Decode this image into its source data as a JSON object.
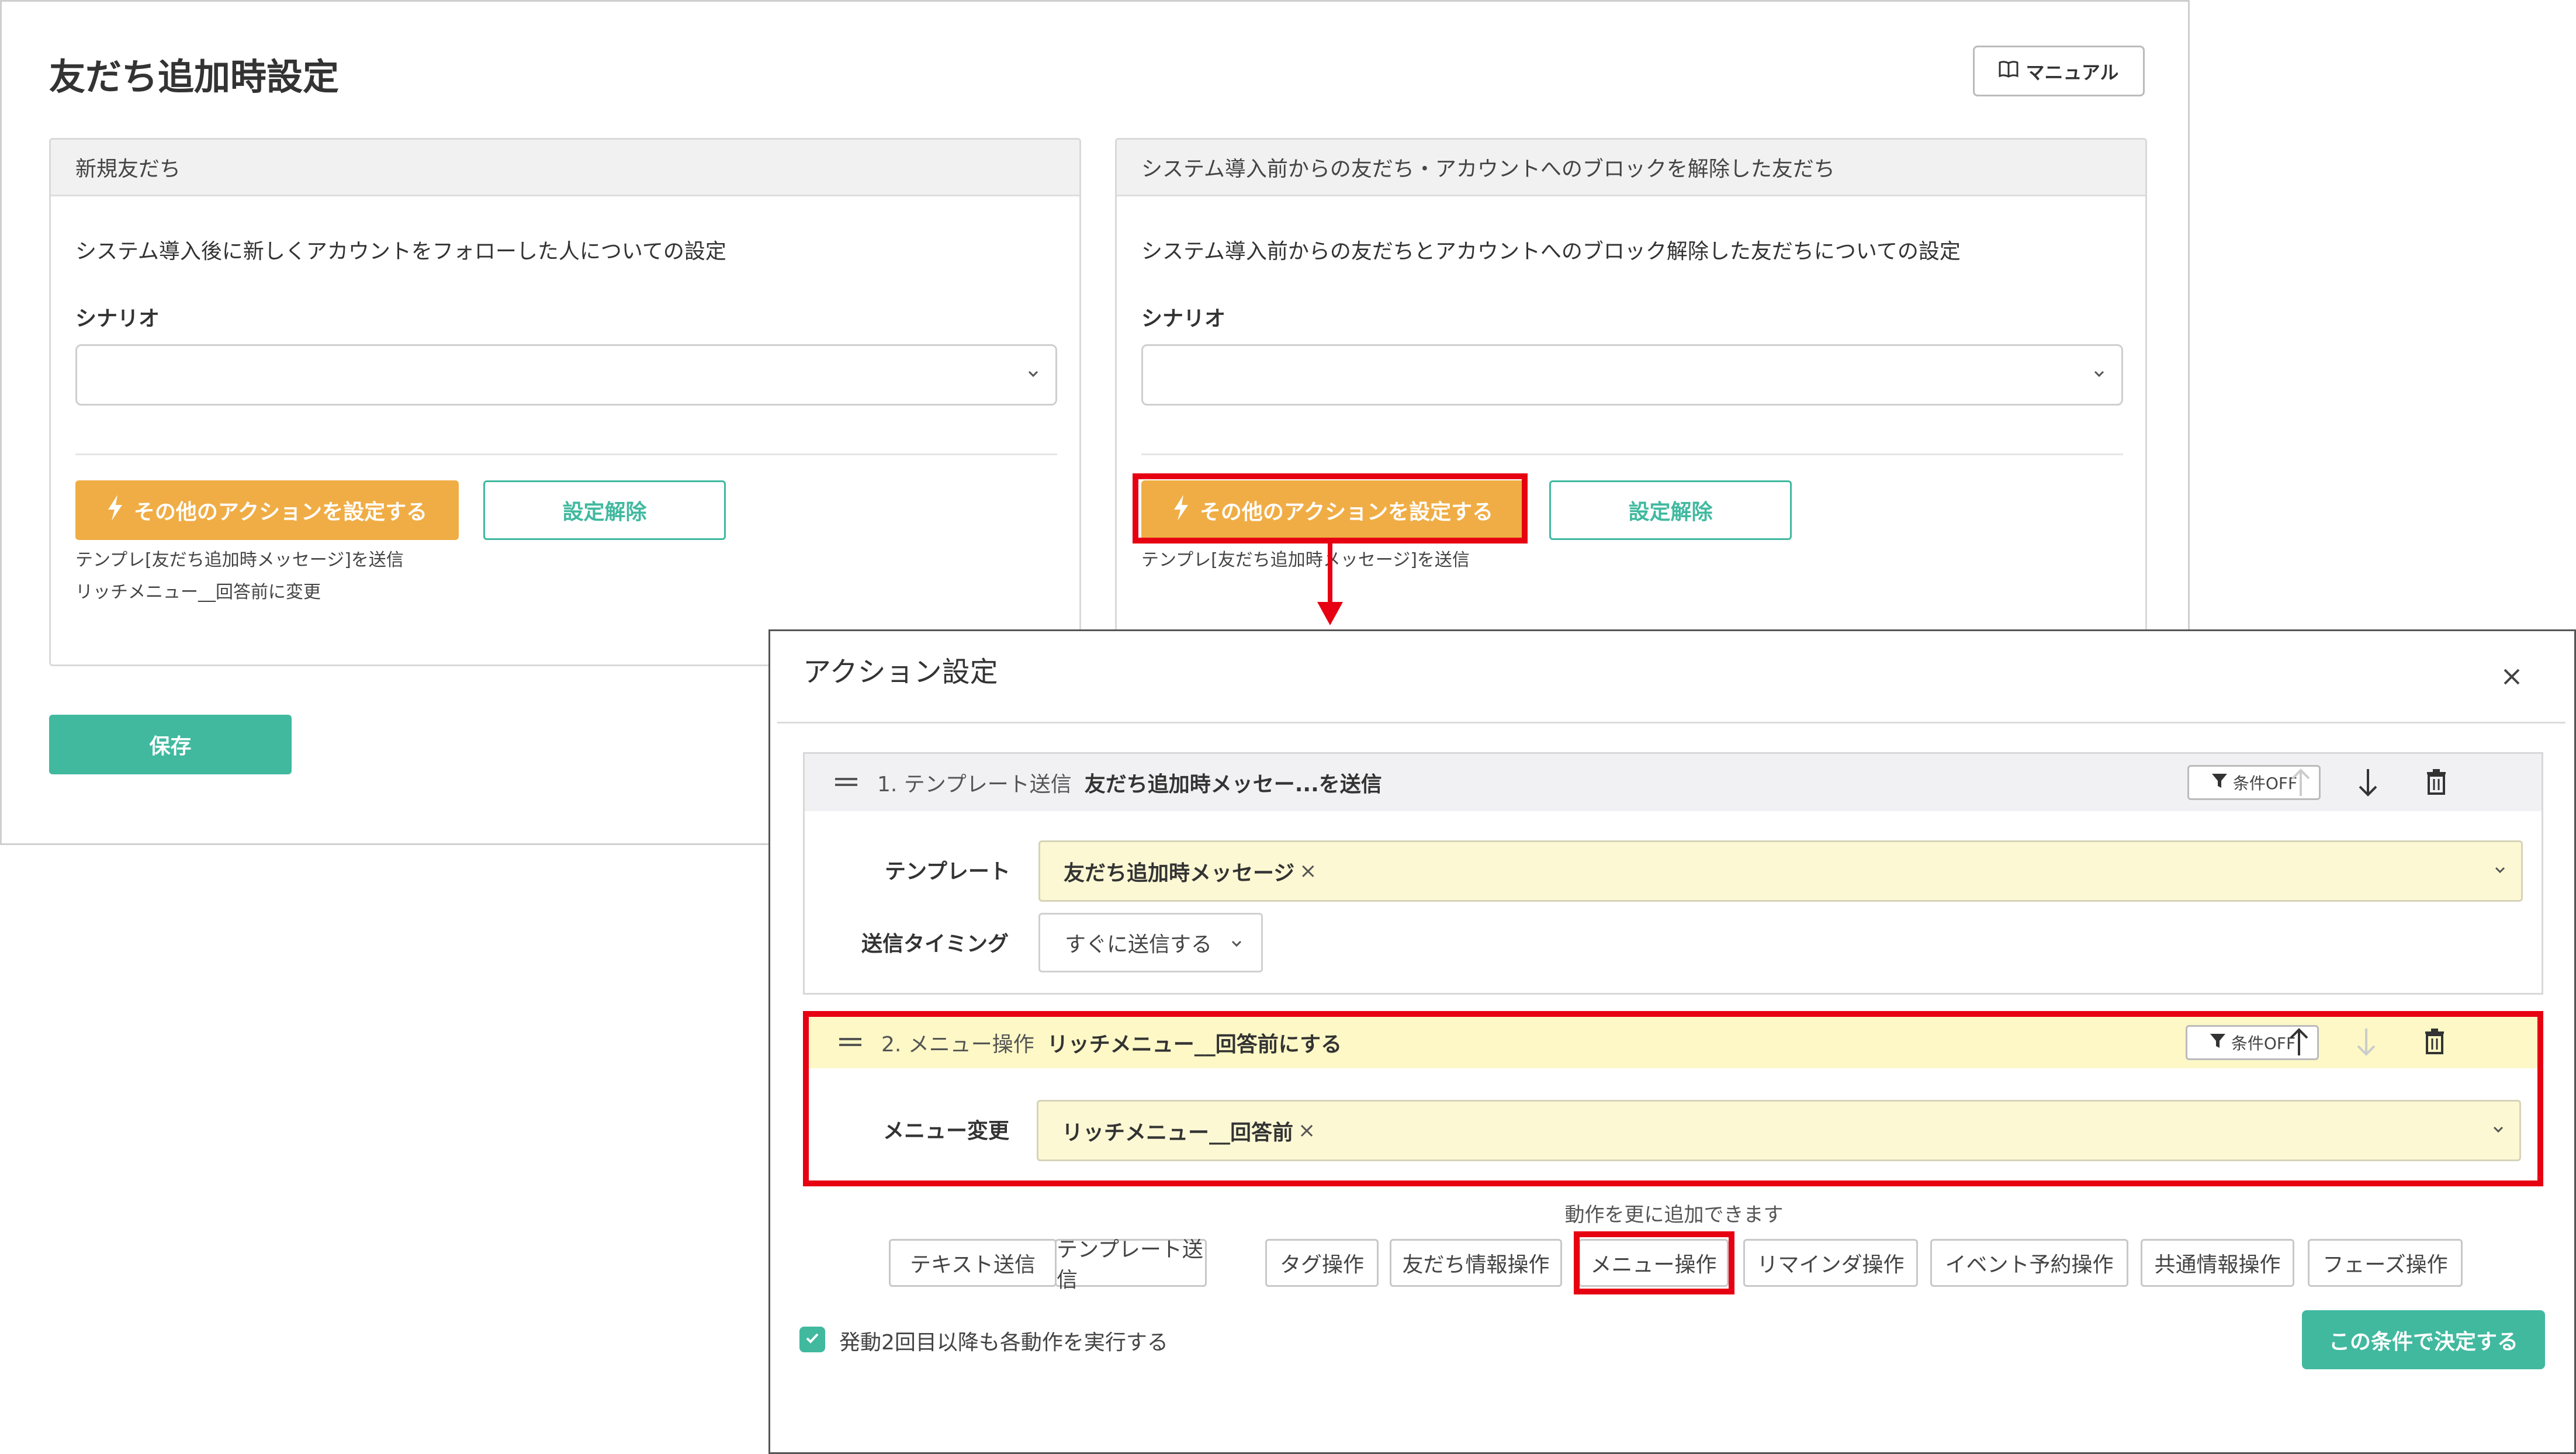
{
  "page": {
    "title": "友だち追加時設定",
    "manual_label": "マニュアル",
    "save_label": "保存"
  },
  "panels": [
    {
      "header": "新規友だち",
      "description": "システム導入後に新しくアカウントをフォローした人についての設定",
      "scenario_label": "シナリオ",
      "scenario_value": "",
      "action_button": "その他のアクションを設定する",
      "reset_button": "設定解除",
      "summary": [
        "テンプレ[友だち追加時メッセージ]を送信",
        "リッチメニュー__回答前に変更"
      ]
    },
    {
      "header": "システム導入前からの友だち・アカウントへのブロックを解除した友だち",
      "description": "システム導入前からの友だちとアカウントへのブロック解除した友だちについての設定",
      "scenario_label": "シナリオ",
      "scenario_value": "",
      "action_button": "その他のアクションを設定する",
      "reset_button": "設定解除",
      "summary": [
        "テンプレ[友だち追加時メッセージ]を送信"
      ]
    }
  ],
  "modal": {
    "title": "アクション設定",
    "actions": [
      {
        "number_label": "1. テンプレート送信",
        "summary": "友だち追加時メッセー...を送信",
        "condition_label": "条件OFF",
        "fields": [
          {
            "label": "テンプレート",
            "value": "友だち追加時メッセージ",
            "remove": "×"
          },
          {
            "label": "送信タイミング",
            "value": "すぐに送信する"
          }
        ]
      },
      {
        "number_label": "2. メニュー操作",
        "summary": "リッチメニュー__回答前にする",
        "condition_label": "条件OFF",
        "fields": [
          {
            "label": "メニュー変更",
            "value": "リッチメニュー__回答前",
            "remove": "×"
          }
        ]
      }
    ],
    "add_more_text": "動作を更に追加できます",
    "add_buttons": [
      "テキスト送信",
      "テンプレート送信",
      "タグ操作",
      "友だち情報操作",
      "メニュー操作",
      "リマインダ操作",
      "イベント予約操作",
      "共通情報操作",
      "フェーズ操作"
    ],
    "repeat_label": "発動2回目以降も各動作を実行する",
    "repeat_checked": true,
    "confirm_label": "この条件で決定する"
  },
  "colors": {
    "accent_orange": "#f0ad45",
    "accent_green": "#40b99f",
    "highlight_red": "#e60012",
    "field_yellow": "#fdf8d4"
  },
  "icons": [
    "book-icon",
    "lightning-icon",
    "chevron-down-icon",
    "close-icon",
    "drag-handle-icon",
    "filter-icon",
    "arrow-up-icon",
    "arrow-down-icon",
    "trash-icon",
    "check-icon"
  ]
}
